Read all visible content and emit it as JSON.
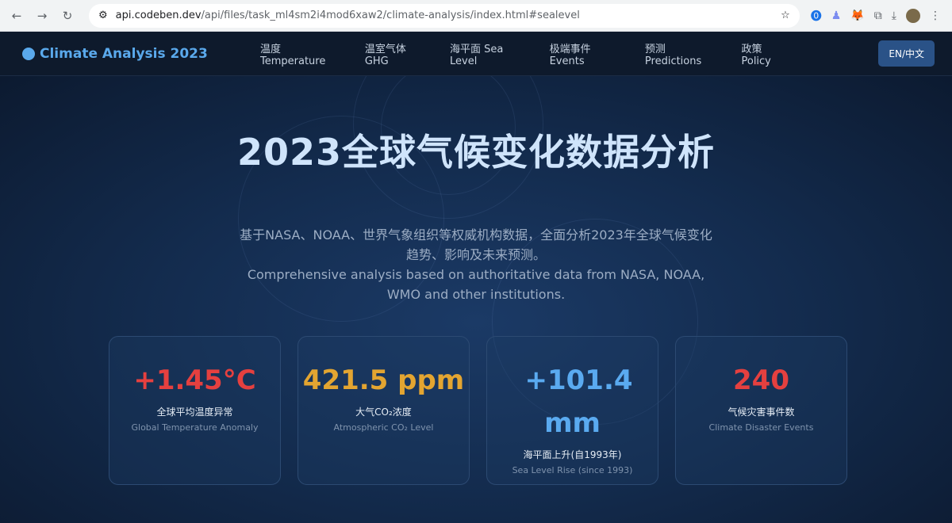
{
  "browser": {
    "url_host": "api.codeben.dev",
    "url_path": "/api/files/task_ml4sm2i4mod6xaw2/climate-analysis/index.html#sealevel"
  },
  "nav": {
    "logo": "Climate Analysis 2023",
    "links": [
      "温度 Temperature",
      "温室气体 GHG",
      "海平面 Sea Level",
      "极端事件 Events",
      "预测 Predictions",
      "政策 Policy"
    ],
    "lang": "EN/中文"
  },
  "hero": {
    "title": "2023全球气候变化数据分析",
    "sub_zh": "基于NASA、NOAA、世界气象组织等权威机构数据，全面分析2023年全球气候变化趋势、影响及未来预测。",
    "sub_en": "Comprehensive analysis based on authoritative data from NASA, NOAA, WMO and other institutions."
  },
  "cards": [
    {
      "value": "+1.45°C",
      "zh": "全球平均温度异常",
      "en": "Global Temperature Anomaly",
      "color": "#e5403f"
    },
    {
      "value": "421.5 ppm",
      "zh": "大气CO₂浓度",
      "en": "Atmospheric CO₂ Level",
      "color": "#e3a531"
    },
    {
      "value": "+101.4 mm",
      "zh": "海平面上升(自1993年)",
      "en": "Sea Level Rise (since 1993)",
      "color": "#5aaaf0"
    },
    {
      "value": "240",
      "zh": "气候灾害事件数",
      "en": "Climate Disaster Events",
      "color": "#e5403f"
    }
  ]
}
